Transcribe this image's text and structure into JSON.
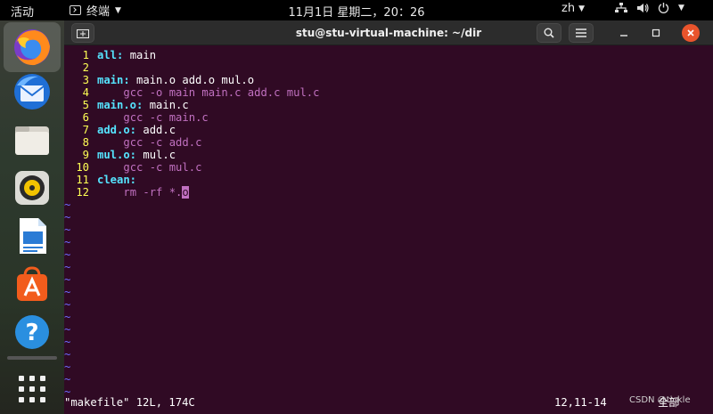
{
  "topbar": {
    "activities": "活动",
    "app_name": "终端",
    "clock": "11月1日 星期二，20：26",
    "lang": "zh"
  },
  "dock": {
    "items": [
      "firefox-icon",
      "thunderbird-icon",
      "files-icon",
      "rhythmbox-icon",
      "libreoffice-writer-icon",
      "app-center-icon",
      "help-icon",
      "show-apps-icon"
    ]
  },
  "window": {
    "title": "stu@stu-virtual-machine: ~/dir"
  },
  "editor": {
    "lines": [
      {
        "n": "1",
        "label": "all:",
        "rest": " main",
        "cmd": ""
      },
      {
        "n": "2",
        "label": "",
        "rest": "",
        "cmd": ""
      },
      {
        "n": "3",
        "label": "main:",
        "rest": " main.o add.o mul.o",
        "cmd": ""
      },
      {
        "n": "4",
        "label": "",
        "rest": "",
        "cmd": "gcc -o main main.c add.c mul.c"
      },
      {
        "n": "5",
        "label": "main.o:",
        "rest": " main.c",
        "cmd": ""
      },
      {
        "n": "6",
        "label": "",
        "rest": "",
        "cmd": "gcc -c main.c"
      },
      {
        "n": "7",
        "label": "add.o:",
        "rest": " add.c",
        "cmd": ""
      },
      {
        "n": "8",
        "label": "",
        "rest": "",
        "cmd": "gcc -c add.c"
      },
      {
        "n": "9",
        "label": "mul.o:",
        "rest": " mul.c",
        "cmd": ""
      },
      {
        "n": "10",
        "label": "",
        "rest": "",
        "cmd": "gcc -c mul.c"
      },
      {
        "n": "11",
        "label": "clean:",
        "rest": "",
        "cmd": ""
      },
      {
        "n": "12",
        "label": "",
        "rest": "",
        "cmd": "rm -rf *."
      }
    ],
    "cursor_char": "o",
    "tilde": "~",
    "tilde_count": 16,
    "status_file": "\"makefile\" 12L, 174C",
    "status_pos": "12,11-14",
    "status_mode": "全部"
  },
  "watermark": "CSDN @tickle",
  "colors": {
    "terminal_bg": "#300a24",
    "line_number": "#ffff54",
    "keyword": "#55e4ff",
    "command": "#c070c0",
    "tilde": "#6c6cff",
    "close_button": "#e9542c"
  }
}
